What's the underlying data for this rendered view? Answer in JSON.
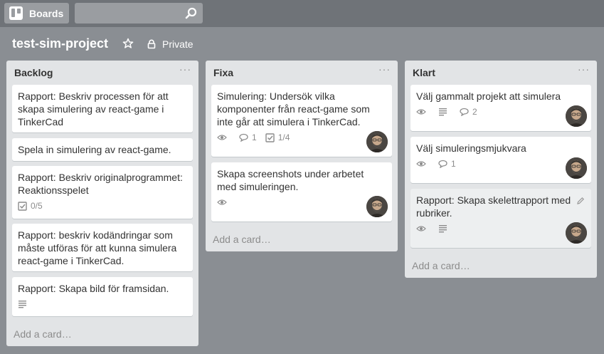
{
  "topbar": {
    "boards_label": "Boards",
    "search_value": "",
    "search_placeholder": ""
  },
  "board": {
    "title": "test-sim-project",
    "visibility": "Private"
  },
  "lists": [
    {
      "title": "Backlog",
      "menu": "···",
      "add_card": "Add a card…",
      "cards": [
        {
          "title": "Rapport: Beskriv processen för att skapa simulering av react-game i TinkerCad"
        },
        {
          "title": "Spela in simulering av react-game."
        },
        {
          "title": "Rapport: Beskriv originalprogrammet: Reaktionsspelet",
          "checklist": "0/5"
        },
        {
          "title": "Rapport: beskriv kodändringar som måste utföras för att kunna simulera react-game i TinkerCad."
        },
        {
          "title": "Rapport: Skapa bild för framsidan.",
          "description": true
        }
      ]
    },
    {
      "title": "Fixa",
      "menu": "···",
      "add_card": "Add a card…",
      "cards": [
        {
          "title": "Simulering: Undersök vilka komponenter från react-game som inte går att simulera i TinkerCad.",
          "watch": true,
          "comments": "1",
          "checklist": "1/4",
          "member": true
        },
        {
          "title": "Skapa screenshots under arbetet med simuleringen.",
          "watch": true,
          "member": true
        }
      ]
    },
    {
      "title": "Klart",
      "menu": "···",
      "add_card": "Add a card…",
      "cards": [
        {
          "title": "Välj gammalt projekt att simulera",
          "watch": true,
          "description": true,
          "comments": "2",
          "member": true
        },
        {
          "title": "Välj simuleringsmjukvara",
          "watch": true,
          "comments": "1",
          "member": true
        },
        {
          "title": "Rapport: Skapa skelettrapport med rubriker.",
          "watch": true,
          "description": true,
          "member": true
        }
      ]
    }
  ],
  "colors": {
    "board_bg": "#8a8e93",
    "topbar_bg": "#6f7378",
    "list_bg": "#e2e4e6",
    "card_bg": "#ffffff"
  }
}
